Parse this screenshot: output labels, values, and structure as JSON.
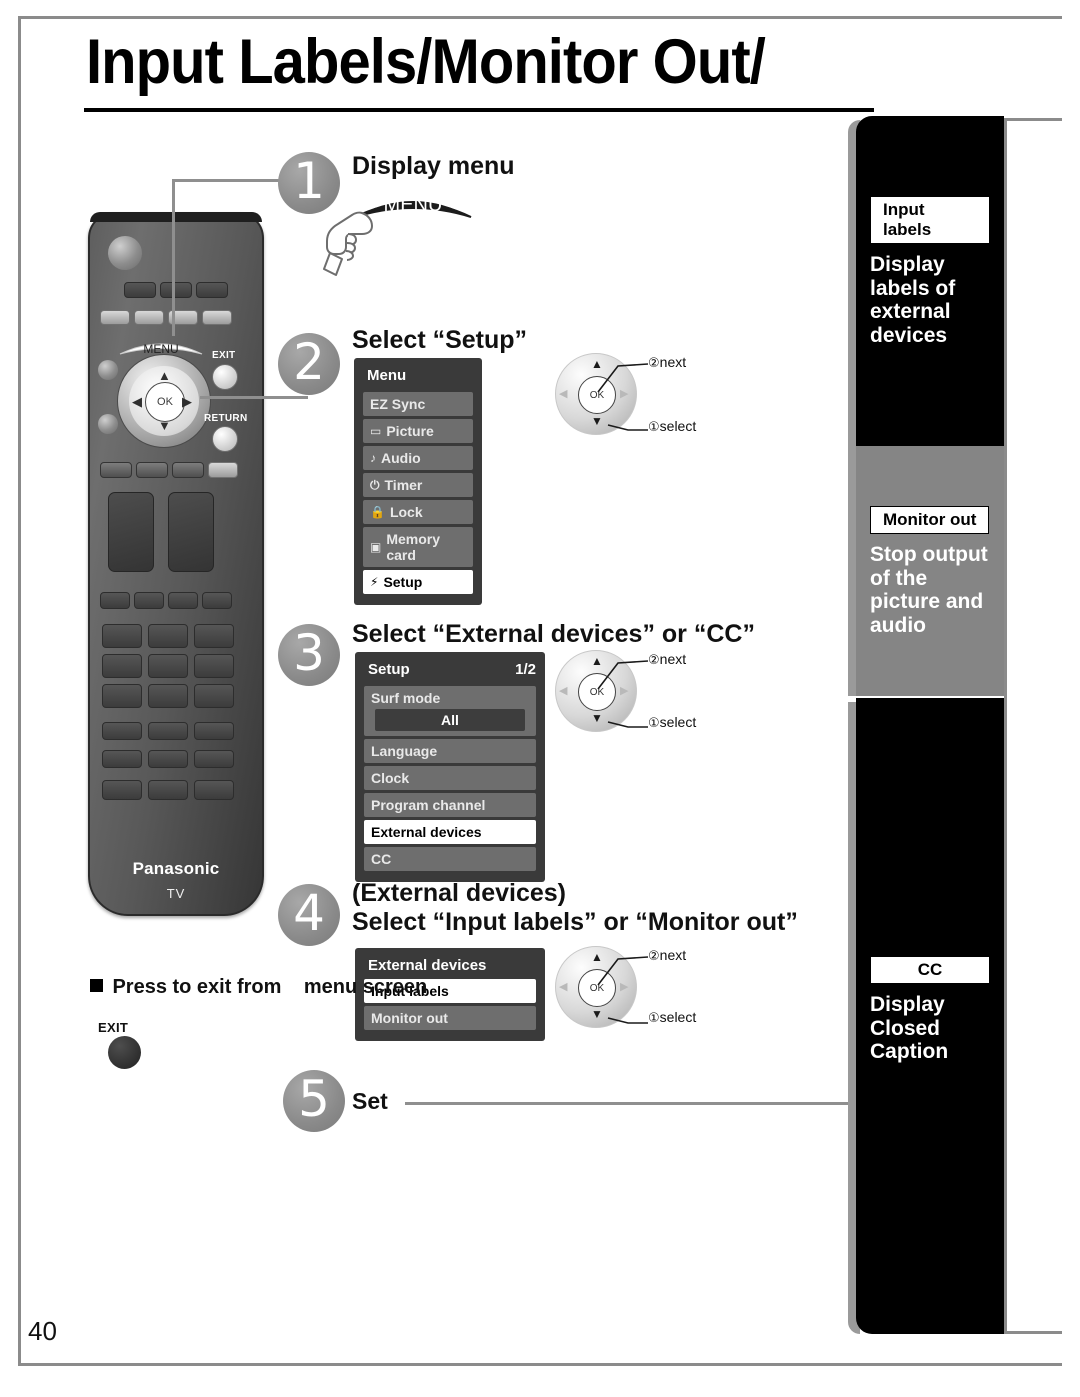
{
  "page": {
    "title": "Input Labels/Monitor Out/",
    "number": "40"
  },
  "steps": [
    {
      "num": "1",
      "title": "Display menu",
      "button_label": "MENU"
    },
    {
      "num": "2",
      "title": "Select “Setup”"
    },
    {
      "num": "3",
      "title": "Select “External devices” or “CC”"
    },
    {
      "num": "4",
      "title_line1": "(External devices)",
      "title_line2": "Select “Input labels” or “Monitor out”"
    },
    {
      "num": "5",
      "title": "Set"
    }
  ],
  "menu_panel": {
    "title": "Menu",
    "rows": [
      {
        "icon": "",
        "label": "EZ Sync",
        "selected": false
      },
      {
        "icon": "▭",
        "label": "Picture",
        "selected": false
      },
      {
        "icon": "♪",
        "label": "Audio",
        "selected": false
      },
      {
        "icon": "⏻",
        "label": "Timer",
        "selected": false
      },
      {
        "icon": "ὑ2",
        "label": "Lock",
        "selected": false
      },
      {
        "icon": "▣",
        "label": "Memory card",
        "selected": false
      },
      {
        "icon": "⚡",
        "label": "Setup",
        "selected": true
      }
    ]
  },
  "setup_panel": {
    "title": "Setup",
    "page": "1/2",
    "rows": [
      {
        "label": "Surf mode",
        "value": "All",
        "selected": false
      },
      {
        "label": "Language",
        "selected": false
      },
      {
        "label": "Clock",
        "selected": false
      },
      {
        "label": "Program channel",
        "selected": false
      },
      {
        "label": "External devices",
        "selected": true
      },
      {
        "label": "CC",
        "selected": false
      }
    ]
  },
  "external_panel": {
    "title": "External devices",
    "rows": [
      {
        "label": "Input labels",
        "selected": true
      },
      {
        "label": "Monitor out",
        "selected": false
      }
    ]
  },
  "dpad": {
    "ok_label": "OK",
    "next_num": "②",
    "next_label": "next",
    "select_num": "①",
    "select_label": "select",
    "up_arrow": "▲",
    "down_arrow": "▼",
    "left_arrow": "◀",
    "right_arrow": "▶"
  },
  "remote": {
    "menu_label": "MENU",
    "exit_label": "EXIT",
    "return_label": "RETURN",
    "ok_label": "OK",
    "brand": "Panasonic",
    "device": "TV"
  },
  "exit_note": {
    "line1": "Press to exit from",
    "line2": "menu screen",
    "button_label": "EXIT"
  },
  "sidebar": [
    {
      "badge": "Input labels",
      "text": "Display labels of external devices",
      "bg": "#000000",
      "fg": "#ffffff"
    },
    {
      "badge": "Monitor out",
      "text": "Stop output of the picture and audio",
      "bg": "#858585",
      "fg": "#ffffff"
    },
    {
      "badge": "CC",
      "text": "Display Closed Caption",
      "bg": "#000000",
      "fg": "#ffffff"
    }
  ]
}
